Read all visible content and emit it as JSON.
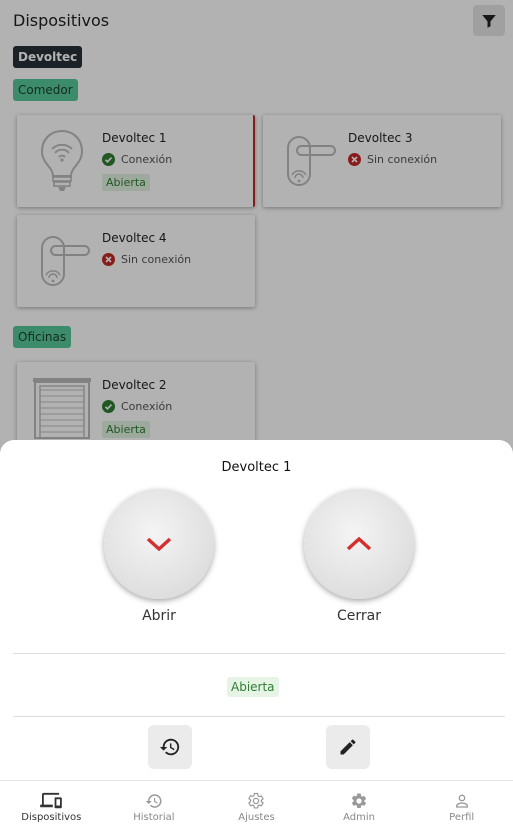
{
  "appbar": {
    "title": "Dispositivos",
    "filter_icon": "filter-icon"
  },
  "company_chip": "Devoltec",
  "groups": [
    {
      "name": "Comedor",
      "devices": [
        {
          "name": "Devoltec 1",
          "status": "Conexión",
          "state": "Abierta",
          "icon": "smart-bulb-icon",
          "connected": true,
          "selected": true
        },
        {
          "name": "Devoltec 3",
          "status": "Sin conexión",
          "state": "",
          "icon": "door-handle-icon",
          "connected": false,
          "selected": false
        },
        {
          "name": "Devoltec 4",
          "status": "Sin conexión",
          "state": "",
          "icon": "door-handle-icon",
          "connected": false,
          "selected": false
        }
      ]
    },
    {
      "name": "Oficinas",
      "devices": [
        {
          "name": "Devoltec 2",
          "status": "Conexión",
          "state": "Abierta",
          "icon": "garage-door-icon",
          "connected": true,
          "selected": false
        }
      ]
    }
  ],
  "sheet": {
    "title": "Devoltec 1",
    "open_label": "Abrir",
    "close_label": "Cerrar",
    "state": "Abierta",
    "history_icon": "history-icon",
    "edit_icon": "edit-icon"
  },
  "nav": [
    {
      "label": "Dispositivos",
      "icon": "devices-icon",
      "active": true
    },
    {
      "label": "Historial",
      "icon": "history-icon",
      "active": false
    },
    {
      "label": "Ajustes",
      "icon": "gear-icon",
      "active": false
    },
    {
      "label": "Admin",
      "icon": "admin-gear-icon",
      "active": false
    },
    {
      "label": "Perfil",
      "icon": "person-icon",
      "active": false
    }
  ],
  "colors": {
    "accent_red": "#c62828",
    "success_green": "#2e7d32",
    "group_chip": "#57c99a",
    "company_chip": "#263238"
  }
}
